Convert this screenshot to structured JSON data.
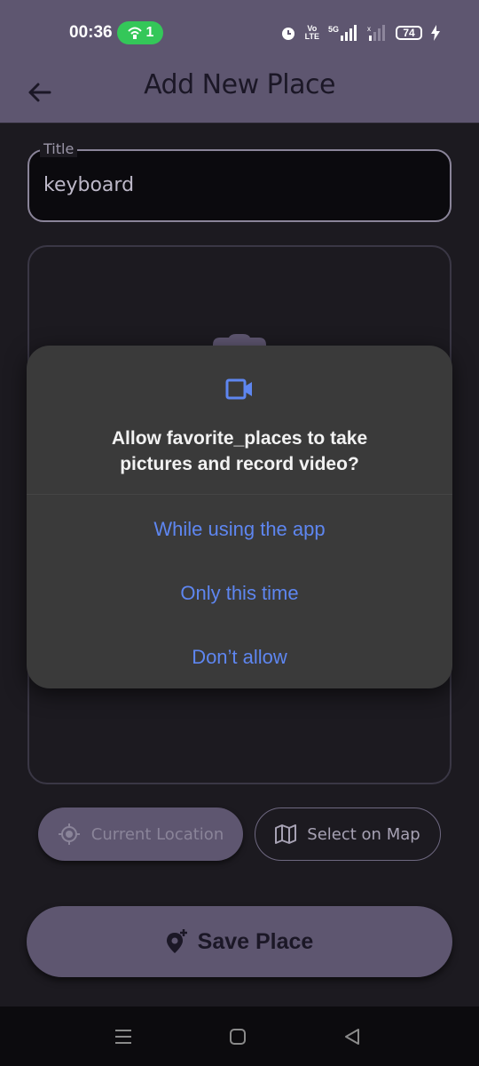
{
  "status_bar": {
    "time": "00:36",
    "hotspot_count": "1",
    "volte_top": "Vo",
    "volte_bottom": "LTE",
    "network_label": "5G",
    "battery": "74"
  },
  "app_bar": {
    "title": "Add New Place"
  },
  "form": {
    "title_label": "Title",
    "title_value": "keyboard"
  },
  "location": {
    "current_location_label": "Current Location",
    "select_on_map_label": "Select on Map"
  },
  "save_button_label": "Save Place",
  "permission_dialog": {
    "line1": "Allow favorite_places to take",
    "line2": "pictures and record video?",
    "options": [
      "While using the app",
      "Only this time",
      "Don’t allow"
    ]
  },
  "colors": {
    "app_bar": "#5e5670",
    "background": "#1c1a20",
    "dialog": "#3a3a3a",
    "dialog_accent": "#5e86f0",
    "hotspot": "#34c759"
  }
}
